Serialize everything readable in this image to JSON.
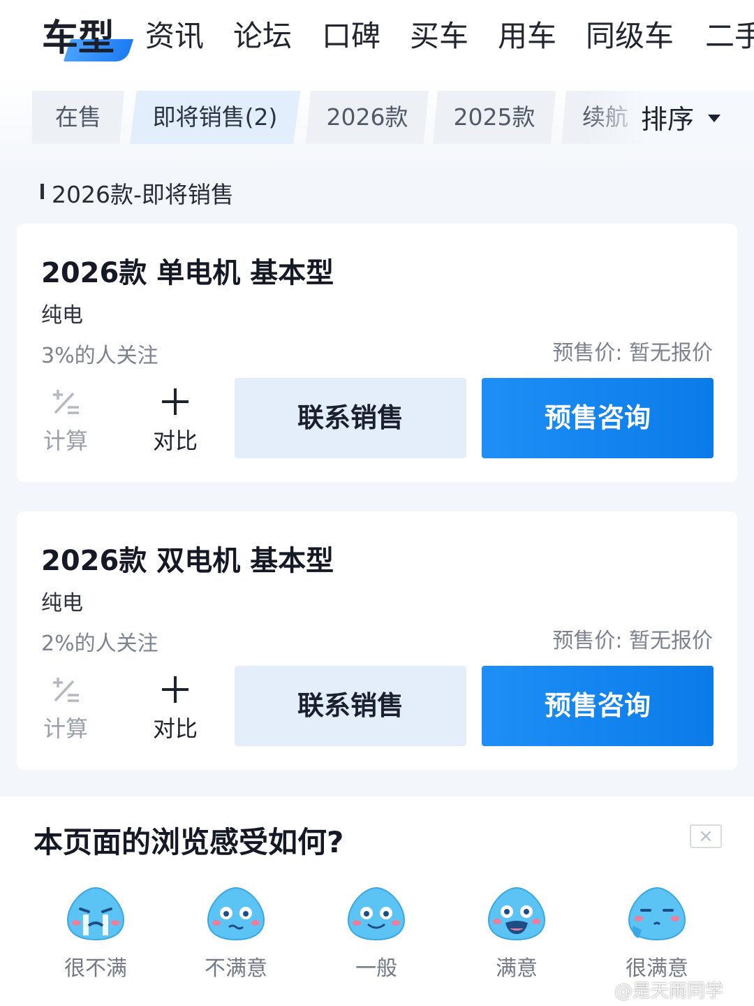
{
  "nav": {
    "tabs": [
      "车型",
      "资讯",
      "论坛",
      "口碑",
      "买车",
      "用车",
      "同级车",
      "二手"
    ]
  },
  "filters": {
    "chips": [
      "在售",
      "即将销售(2)",
      "2026款",
      "2025款",
      "续航"
    ],
    "sort_label": "排序"
  },
  "section": {
    "title": "2026款-即将销售"
  },
  "cards": [
    {
      "title": "2026款 单电机 基本型",
      "type": "纯电",
      "attention": "3%的人关注",
      "price": "预售价: 暂无报价",
      "calc_label": "计算",
      "compare_label": "对比",
      "sales_button": "联系销售",
      "consult_button": "预售咨询"
    },
    {
      "title": "2026款 双电机 基本型",
      "type": "纯电",
      "attention": "2%的人关注",
      "price": "预售价: 暂无报价",
      "calc_label": "计算",
      "compare_label": "对比",
      "sales_button": "联系销售",
      "consult_button": "预售咨询"
    }
  ],
  "feedback": {
    "title": "本页面的浏览感受如何?",
    "close_icon": "×",
    "options": [
      "很不满",
      "不满意",
      "一般",
      "满意",
      "很满意"
    ]
  },
  "watermark": "@是天雨同学",
  "colors": {
    "accent": "#0a7be9",
    "accent_light": "#e3eefa",
    "emoji_body": "#5cc3f5"
  }
}
